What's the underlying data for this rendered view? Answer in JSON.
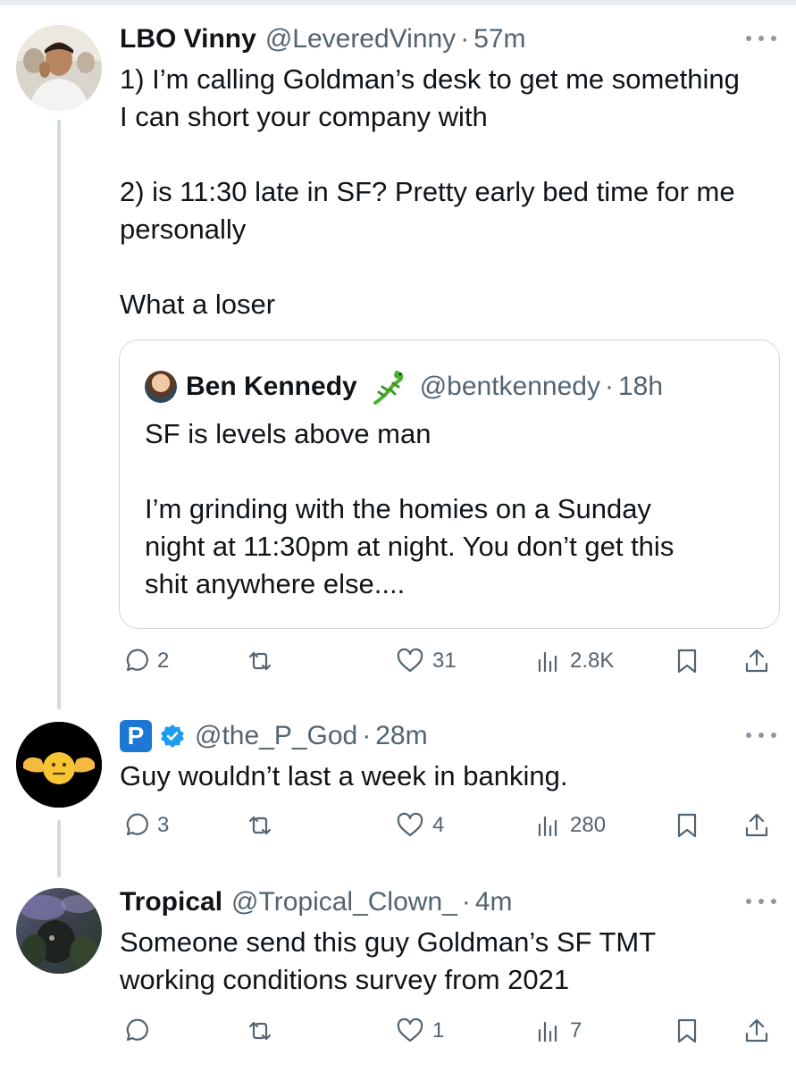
{
  "tweets": [
    {
      "name": "LBO Vinny",
      "handle": "@LeveredVinny",
      "time": "57m",
      "text": "1) I’m calling Goldman’s desk to get me something\nI can short your company with\n\n2) is 11:30 late in SF? Pretty early bed time for me\npersonally\n\nWhat a loser",
      "quote": {
        "name": "Ben Kennedy",
        "handle": "@bentkennedy",
        "time": "18h",
        "text": "SF is levels above man\n\nI’m grinding with the homies on a Sunday\nnight at 11:30pm at night. You don’t get this\nshit anywhere else...."
      },
      "replies": "2",
      "reposts": "",
      "likes": "31",
      "views": "2.8K"
    },
    {
      "name": "",
      "badge": "P",
      "handle": "@the_P_God",
      "time": "28m",
      "text": "Guy wouldn’t last a week in banking.",
      "replies": "3",
      "reposts": "",
      "likes": "4",
      "views": "280"
    },
    {
      "name": "Tropical",
      "handle": "@Tropical_Clown_",
      "time": "4m",
      "text": "Someone send this guy Goldman’s SF TMT\nworking conditions survey from 2021",
      "replies": "",
      "reposts": "",
      "likes": "1",
      "views": "7"
    }
  ],
  "separator": "·",
  "icons": {
    "reply": "reply-bubble-icon",
    "repost": "repost-arrows-icon",
    "like": "heart-icon",
    "views": "bar-chart-icon",
    "bookmark": "bookmark-icon",
    "share": "share-upload-icon",
    "more": "more-dots-icon",
    "verified": "verified-badge-icon",
    "emoji": "lizard-emoji-icon"
  },
  "colors": {
    "text": "#0f1419",
    "secondary": "#536471",
    "border": "#cfd9de",
    "verified": "#1d9bf0",
    "badge": "#1d77d4"
  }
}
